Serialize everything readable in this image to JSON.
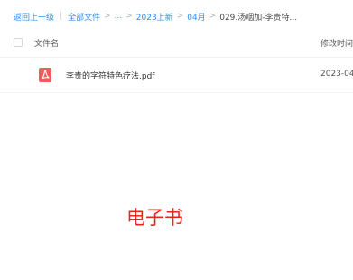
{
  "breadcrumb": {
    "back": "返回上一级",
    "separator": "|",
    "items": [
      "全部文件",
      "...",
      "2023上新",
      "04月"
    ],
    "current": "029.汤咽加-李贵特...",
    "chevron": ">"
  },
  "table": {
    "columns": {
      "name": "文件名",
      "mtime": "修改时间"
    },
    "rows": [
      {
        "icon": "pdf-icon",
        "icon_color": "#f25b5b",
        "name": "李贵的字符特色疗法.pdf",
        "mtime": "2023-04"
      }
    ]
  },
  "overlay": {
    "label": "电子书",
    "color": "#e8261c"
  }
}
